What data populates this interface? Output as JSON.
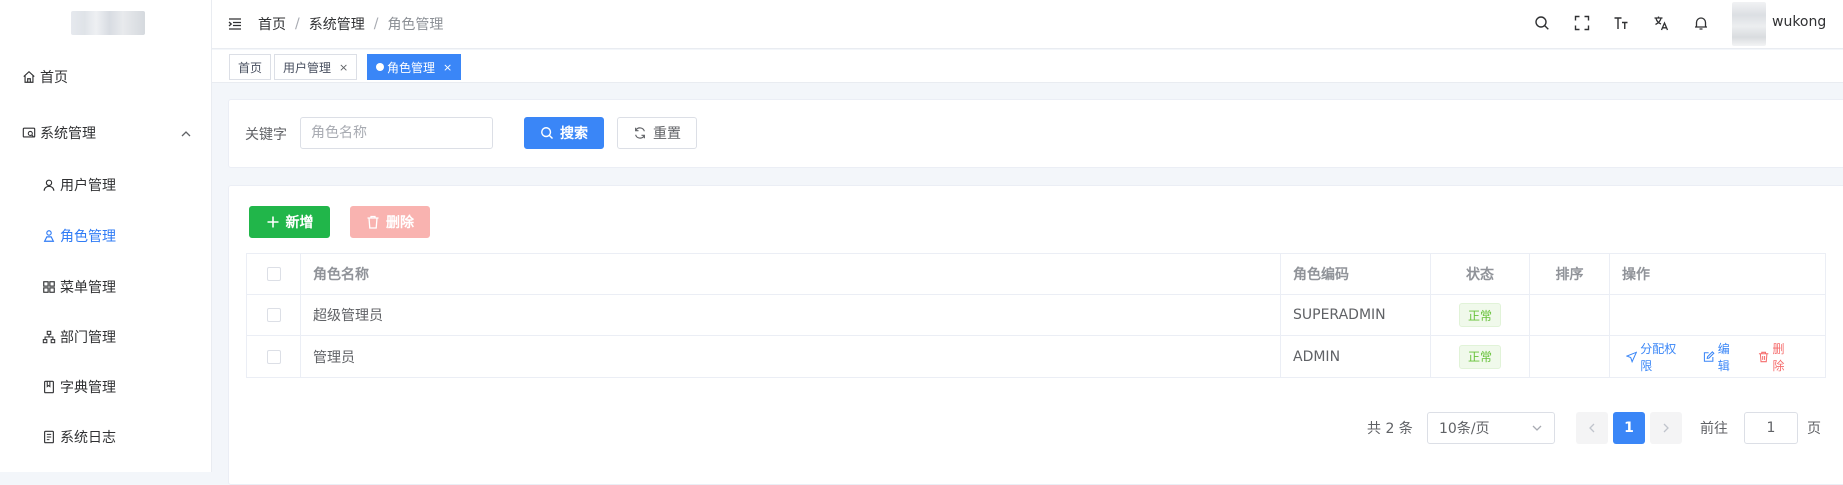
{
  "sidebar": {
    "items": [
      {
        "label": "首页",
        "icon": "home-icon"
      },
      {
        "label": "系统管理",
        "icon": "system-icon"
      },
      {
        "label": "用户管理",
        "icon": "user-icon"
      },
      {
        "label": "角色管理",
        "icon": "role-icon"
      },
      {
        "label": "菜单管理",
        "icon": "menu-icon"
      },
      {
        "label": "部门管理",
        "icon": "dept-icon"
      },
      {
        "label": "字典管理",
        "icon": "dict-icon"
      },
      {
        "label": "系统日志",
        "icon": "log-icon"
      }
    ],
    "active": "角色管理"
  },
  "header": {
    "breadcrumbs": [
      "首页",
      "系统管理",
      "角色管理"
    ],
    "separator": "/",
    "username": "wukong",
    "icons": [
      "search-icon",
      "fullscreen-icon",
      "font-size-icon",
      "translate-icon",
      "bell-icon"
    ]
  },
  "tags": [
    {
      "label": "首页",
      "closable": false,
      "active": false
    },
    {
      "label": "用户管理",
      "closable": true,
      "active": false
    },
    {
      "label": "角色管理",
      "closable": true,
      "active": true
    }
  ],
  "tag_close": "×",
  "search": {
    "keyword_label": "关键字",
    "placeholder": "角色名称",
    "value": "",
    "search_label": "搜索",
    "reset_label": "重置"
  },
  "toolbar": {
    "add_label": "新增",
    "delete_label": "删除"
  },
  "table": {
    "headers": [
      "角色名称",
      "角色编码",
      "状态",
      "排序",
      "操作"
    ],
    "rows": [
      {
        "name": "超级管理员",
        "code": "SUPERADMIN",
        "status": "正常",
        "sort": "",
        "actions": []
      },
      {
        "name": "管理员",
        "code": "ADMIN",
        "status": "正常",
        "sort": "",
        "actions": [
          "分配权限",
          "编辑",
          "删除"
        ]
      }
    ]
  },
  "pagination": {
    "total_text": "共 2 条",
    "page_size": "10条/页",
    "current_page": "1",
    "goto_prefix": "前往",
    "goto_value": "1",
    "goto_suffix": "页"
  },
  "colors": {
    "primary": "#3a86f7",
    "success": "#21b64a",
    "danger": "#f56c6c",
    "danger_disabled": "#f9b3b0",
    "status_green": "#67c23a"
  }
}
